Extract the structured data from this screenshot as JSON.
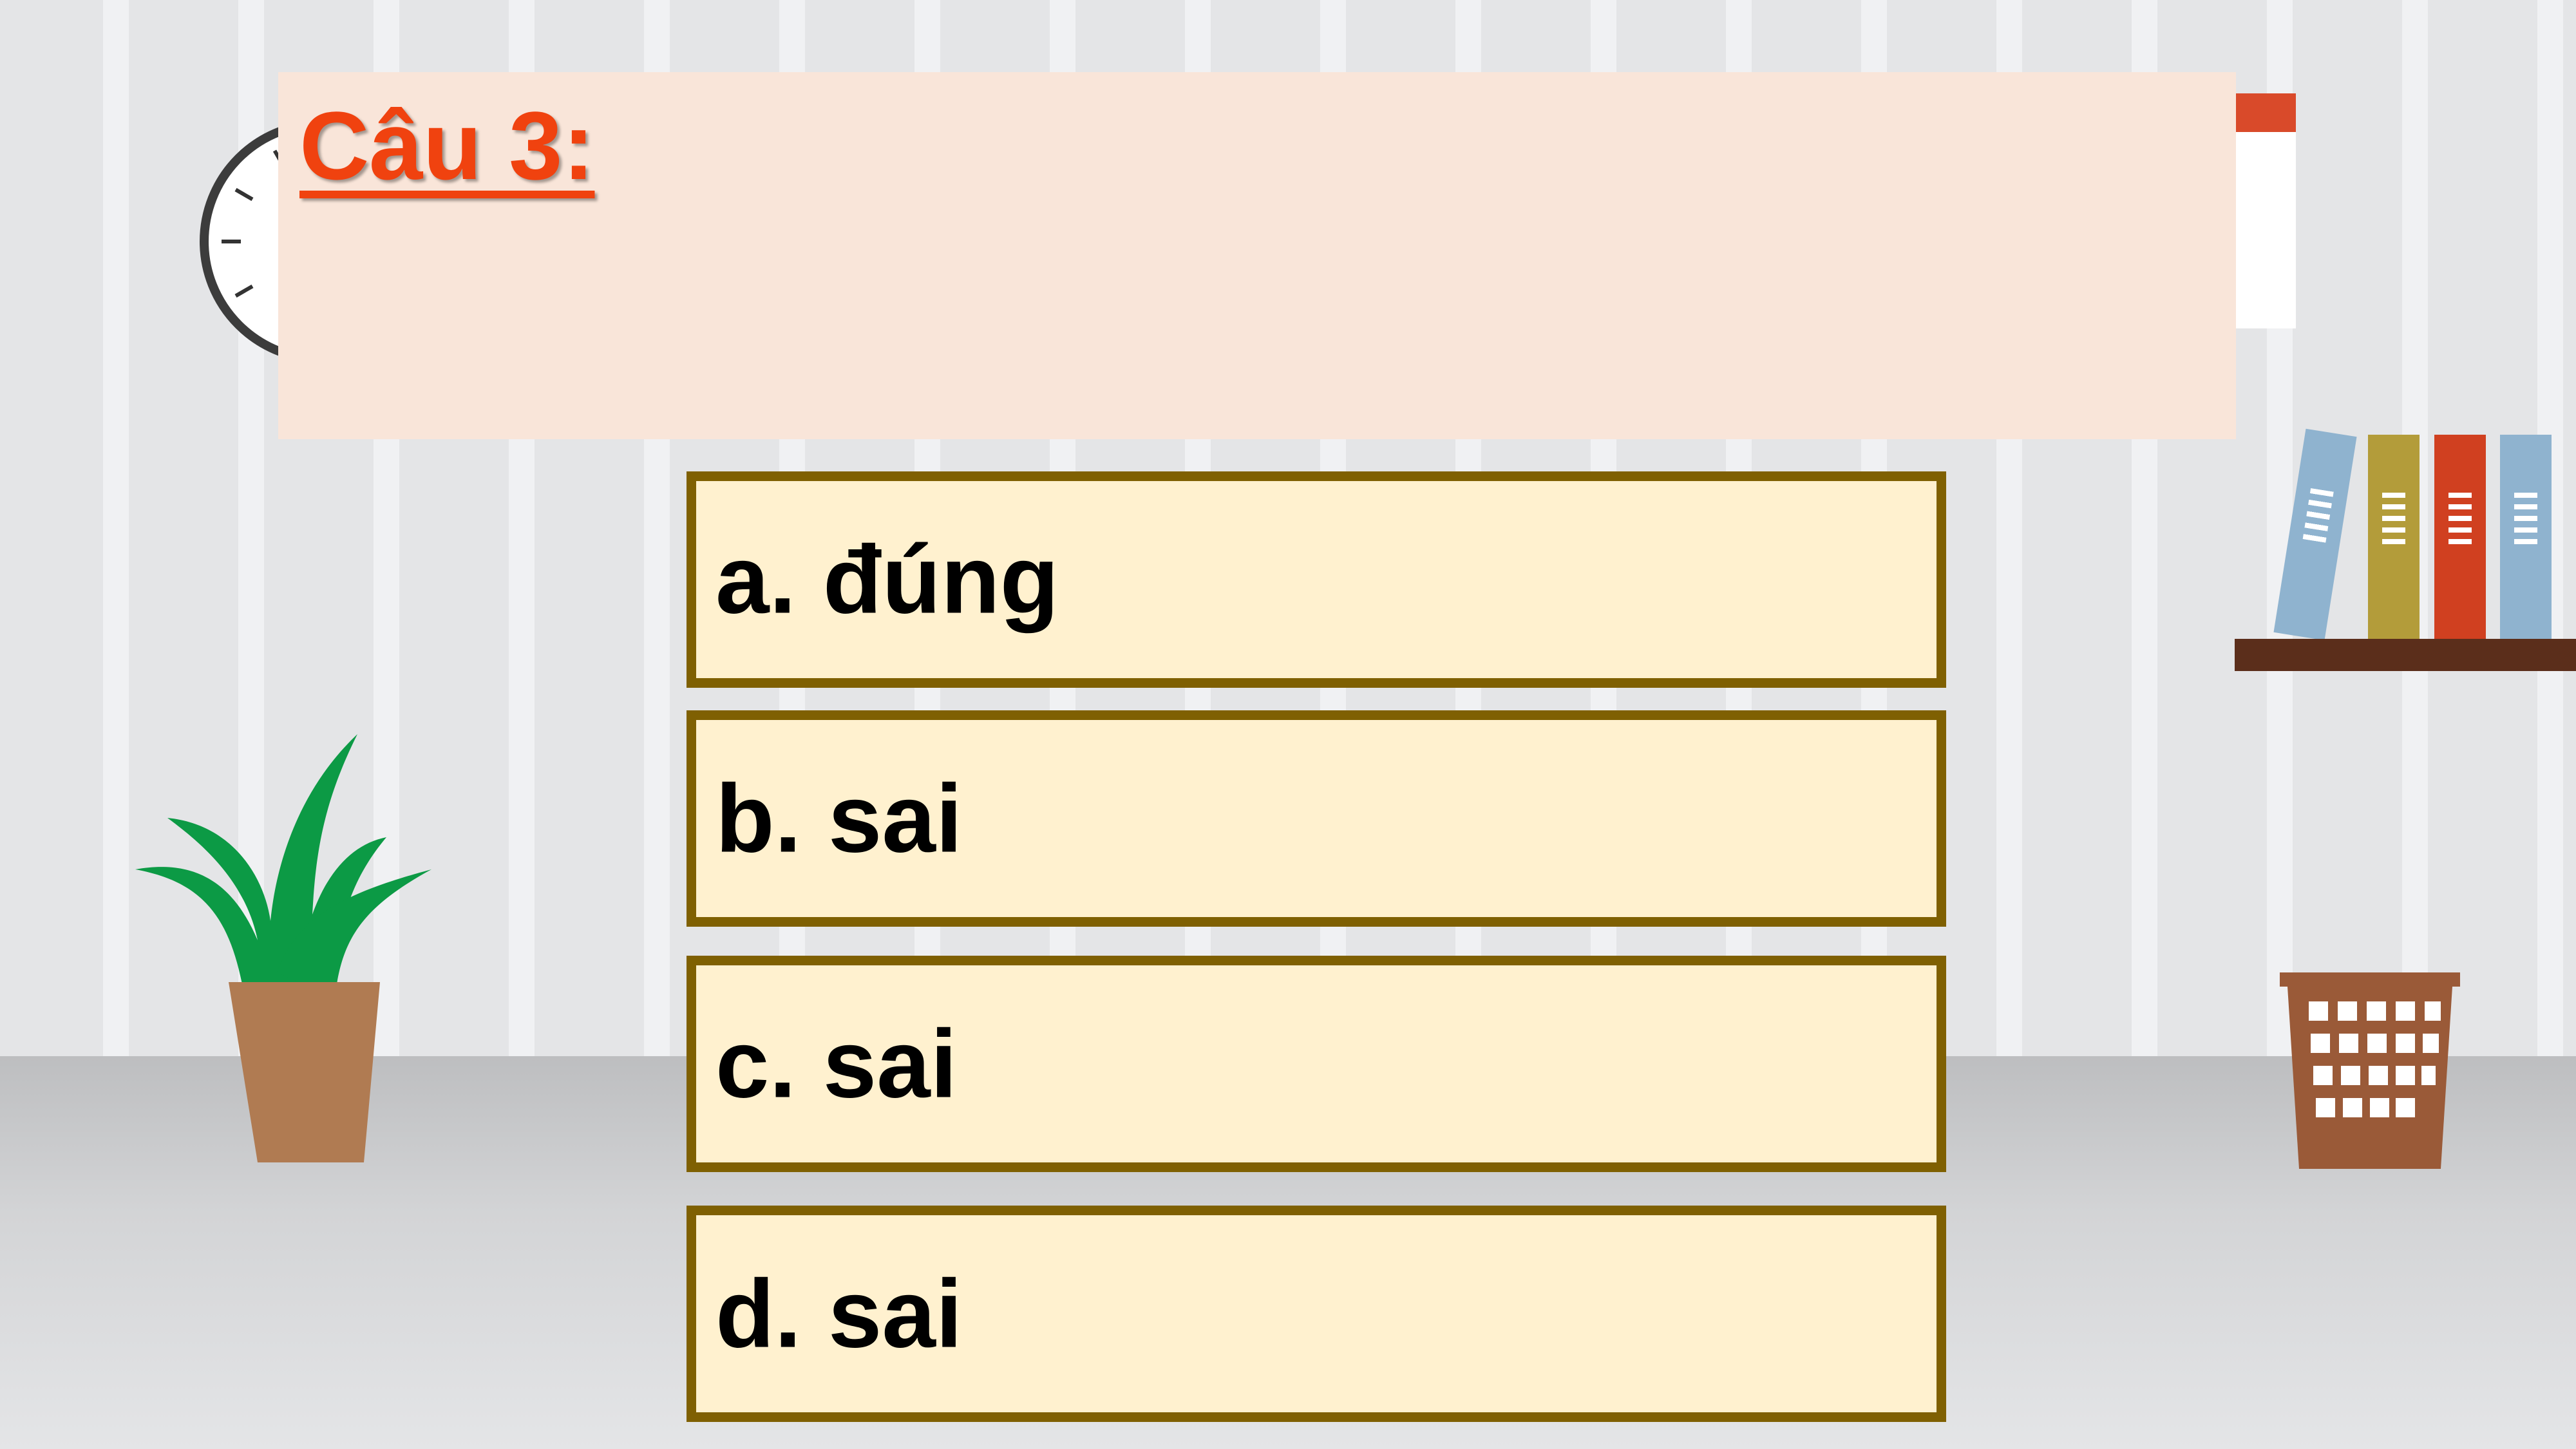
{
  "question": {
    "label": "Câu 3:"
  },
  "options": [
    {
      "text": "a. đúng"
    },
    {
      "text": "b. sai"
    },
    {
      "text": "c. sai"
    },
    {
      "text": "d. sai"
    }
  ],
  "colors": {
    "question_label": "#f0420f",
    "question_panel": "#f9e5d9",
    "option_fill": "#fff1cf",
    "option_border": "#7f6002"
  },
  "decorations": [
    "clock-icon",
    "calendar-icon",
    "books-icon",
    "plant-icon",
    "wastebasket-icon"
  ]
}
